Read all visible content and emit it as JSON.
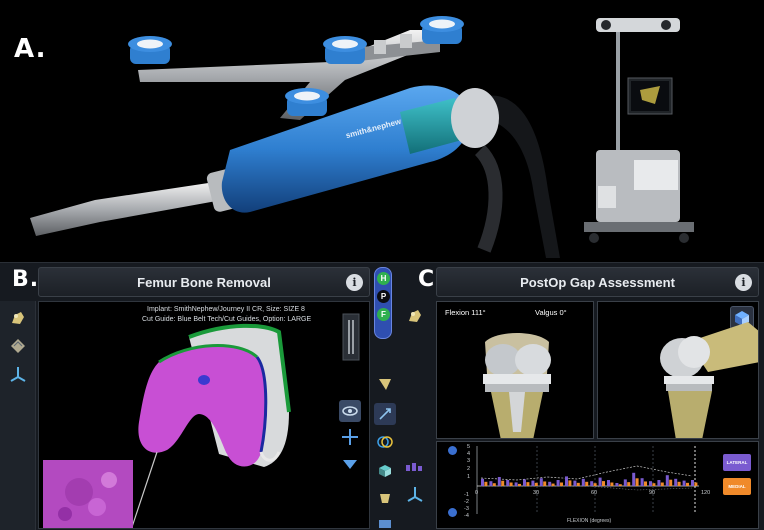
{
  "panels": {
    "a": {
      "letter": "A."
    },
    "b": {
      "letter": "B.",
      "title": "Femur Bone Removal",
      "info_label": "i",
      "implant_line": "Implant: SmithNephew/Journey II CR, Size: SIZE 8",
      "guide_line": "Cut Guide: Blue Belt Tech/Cut Guides, Option: LARGE",
      "mode_labels": [
        "H",
        "P",
        "F"
      ]
    },
    "c": {
      "letter": "C.",
      "title": "PostOp Gap Assessment",
      "info_label": "i",
      "flexion_text": "Flexion  111°",
      "valgus_text": "Valgus  0°",
      "legend": [
        "LATERAL",
        "MEDIAL"
      ],
      "x_ticks": [
        "0",
        "30",
        "60",
        "90",
        "120"
      ],
      "x_axis_label": "FLEXION (degrees)",
      "y_ticks": [
        "5",
        "4",
        "3",
        "2",
        "1",
        "-1",
        "-2",
        "-3",
        "-4"
      ]
    }
  },
  "device": {
    "brand_text": "smith&nephew"
  },
  "colors": {
    "device_blue": "#2f7fd0",
    "bone_magenta": "#c84fd4",
    "lateral": "#7a5bd0",
    "medial": "#f08a2a",
    "mode_active": "#2fb04f",
    "ui_bg": "#161a20"
  }
}
